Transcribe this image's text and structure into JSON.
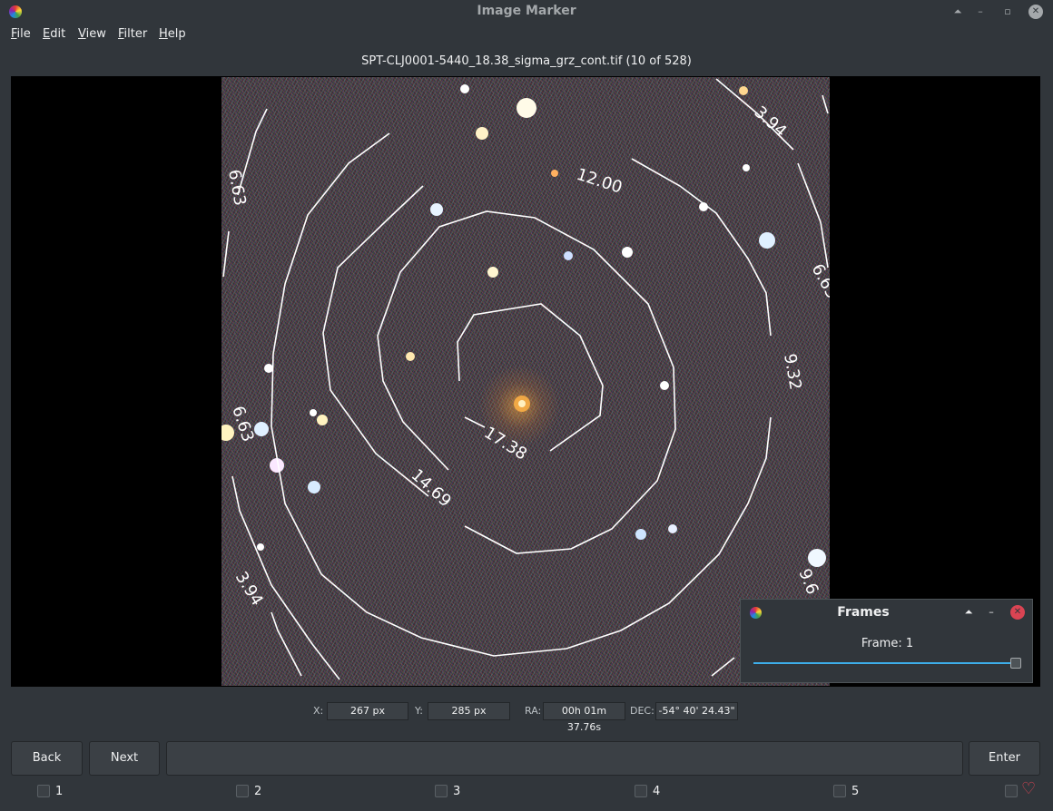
{
  "window": {
    "title": "Image Marker"
  },
  "menu": [
    {
      "label": "File",
      "mnemonic": "F",
      "rest": "ile"
    },
    {
      "label": "Edit",
      "mnemonic": "E",
      "rest": "dit"
    },
    {
      "label": "View",
      "mnemonic": "V",
      "rest": "iew"
    },
    {
      "label": "Filter",
      "mnemonic": "F",
      "rest": "ilter"
    },
    {
      "label": "Help",
      "mnemonic": "H",
      "rest": "elp"
    }
  ],
  "image": {
    "filename": "SPT-CLJ0001-5440_18.38_sigma_grz_cont.tif (10 of 528)",
    "contour_labels": [
      "12.00",
      "3.94",
      "6.63",
      "6.63",
      "6.63",
      "9.32",
      "17.38",
      "14.69",
      "3.94",
      "9.6"
    ]
  },
  "frames_dialog": {
    "title": "Frames",
    "frame_label": "Frame: 1",
    "slider_fraction": 1.0
  },
  "coords": {
    "x_label": "X:",
    "x_value": "267 px",
    "y_label": "Y:",
    "y_value": "285 px",
    "ra_label": "RA:",
    "ra_value": "00h 01m 37.76s",
    "dec_label": "DEC:",
    "dec_value": "-54° 40' 24.43\""
  },
  "controls": {
    "back": "Back",
    "next": "Next",
    "comment_value": "",
    "enter": "Enter"
  },
  "categories": [
    "1",
    "2",
    "3",
    "4",
    "5"
  ],
  "colors": {
    "background": "#31363b",
    "accent": "#3daee9",
    "favorite": "#da4453"
  },
  "icons": [
    "app-logo-icon",
    "keep-above-icon",
    "minimize-icon",
    "restore-icon",
    "close-icon",
    "heart-icon"
  ]
}
